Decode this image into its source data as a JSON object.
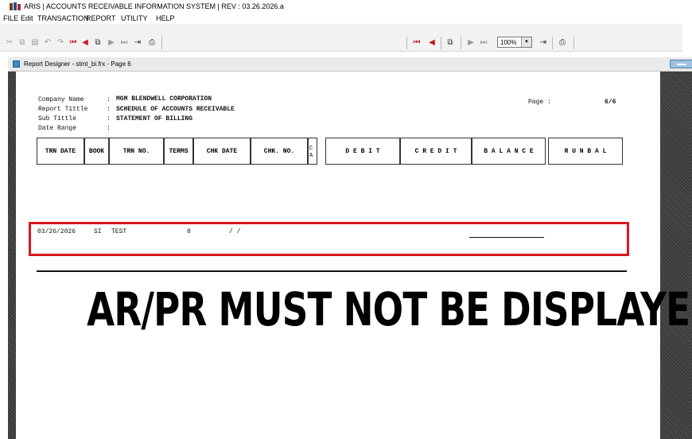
{
  "window": {
    "title": "ARIS | ACCOUNTS RECEIVABLE INFORMATION SYSTEM |  REV : 03.26.2026.a"
  },
  "menu": [
    "FILE",
    "Edit",
    "TRANSACTION",
    "REPORT",
    "UTILITY",
    "HELP"
  ],
  "toolbar": {
    "left_icons": [
      "cut-icon",
      "copy-icon",
      "paste-icon",
      "undo-icon",
      "redo-icon",
      "first-page-icon",
      "prev-page-icon",
      "multi-page-icon",
      "next-page-icon",
      "last-page-icon",
      "exit-icon",
      "print-icon"
    ],
    "zoom": "100%"
  },
  "designer": {
    "title": "Report Designer - stmt_bi.frx - Page 6"
  },
  "report": {
    "company_label": "Company Name",
    "company_value": "MGM BLENDWELL CORPORATION",
    "title_label": "Report Tittle",
    "title_value": "SCHEDULE OF ACCOUNTS RECEIVABLE",
    "subtitle_label": "Sub Tittle",
    "subtitle_value": "STATEMENT OF BILLING",
    "date_range_label": "Date Range",
    "colon": ":",
    "page_label": "Page :",
    "page_value": "6/6",
    "columns": [
      "TRN DATE",
      "BOOK",
      "TRN NO.",
      "TERMS",
      "CHK DATE",
      "CHK. NO.",
      "D E B I T",
      "C R E D I T",
      "B A L A N C E",
      "R U N B A L"
    ],
    "ca_top": "C",
    "ca_bottom": "A",
    "detail": {
      "trn_date": "03/26/2026",
      "book": "SI",
      "trn_no": "TEST",
      "terms": "0",
      "chk_date": "/  /"
    },
    "banner": "AR/PR MUST NOT BE DISPLAYED"
  },
  "colors": {
    "highlight": "#d71920",
    "designer_bg": "#3a3a3a"
  }
}
